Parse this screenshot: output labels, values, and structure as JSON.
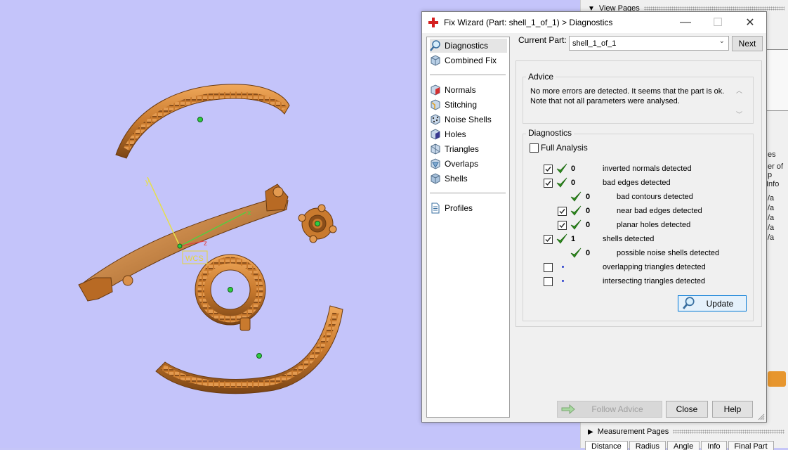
{
  "dialog": {
    "title": "Fix Wizard (Part: shell_1_of_1) > Diagnostics",
    "minimize": "—",
    "maximize": "☐",
    "close": "✕"
  },
  "nav": {
    "items": [
      {
        "label": "Diagnostics",
        "icon": "magnifier-icon"
      },
      {
        "label": "Combined Fix",
        "icon": "cube-icon"
      },
      {
        "label": "Normals",
        "icon": "normals-icon"
      },
      {
        "label": "Stitching",
        "icon": "stitching-icon"
      },
      {
        "label": "Noise Shells",
        "icon": "noise-shells-icon"
      },
      {
        "label": "Holes",
        "icon": "holes-icon"
      },
      {
        "label": "Triangles",
        "icon": "triangles-icon"
      },
      {
        "label": "Overlaps",
        "icon": "overlaps-icon"
      },
      {
        "label": "Shells",
        "icon": "shells-icon"
      },
      {
        "label": "Profiles",
        "icon": "document-icon"
      }
    ]
  },
  "current_part": {
    "label": "Current Part:",
    "value": "shell_1_of_1",
    "next": "Next"
  },
  "advice": {
    "title": "Advice",
    "text_line1": "No more errors are detected. It seems that the part is ok.",
    "text_line2": "Note that not all parameters were analysed."
  },
  "diagnostics": {
    "title": "Diagnostics",
    "full_analysis": "Full Analysis",
    "rows": [
      {
        "value": "0",
        "label": "inverted normals detected"
      },
      {
        "value": "0",
        "label": "bad edges detected"
      },
      {
        "value": "0",
        "label": "bad contours detected"
      },
      {
        "value": "0",
        "label": "near bad edges detected"
      },
      {
        "value": "0",
        "label": "planar holes detected"
      },
      {
        "value": "1",
        "label": "shells detected"
      },
      {
        "value": "0",
        "label": "possible noise shells detected"
      },
      {
        "value": "",
        "label": "overlapping triangles detected"
      },
      {
        "value": "",
        "label": "intersecting triangles detected"
      }
    ],
    "update": "Update"
  },
  "footer": {
    "follow_advice": "Follow Advice",
    "close": "Close",
    "help": "Help"
  },
  "viewport": {
    "axis_y": "y",
    "axis_x": "x",
    "axis_z": "z",
    "wcs": "WCS"
  },
  "background_panel": {
    "view_pages": "View Pages",
    "measurement_pages": "Measurement Pages",
    "tabs": [
      "Distance",
      "Radius",
      "Angle",
      "Info",
      "Final Part"
    ],
    "frag_es": "es",
    "frag_er": "er of p",
    "frag_info": "Info",
    "frag_a": "/a"
  },
  "colors": {
    "viewport_bg": "#c4c4fa",
    "part_orange": "#c97a2e",
    "check_green": "#2e8b1e",
    "wcs_yellow": "#e6d63a"
  }
}
